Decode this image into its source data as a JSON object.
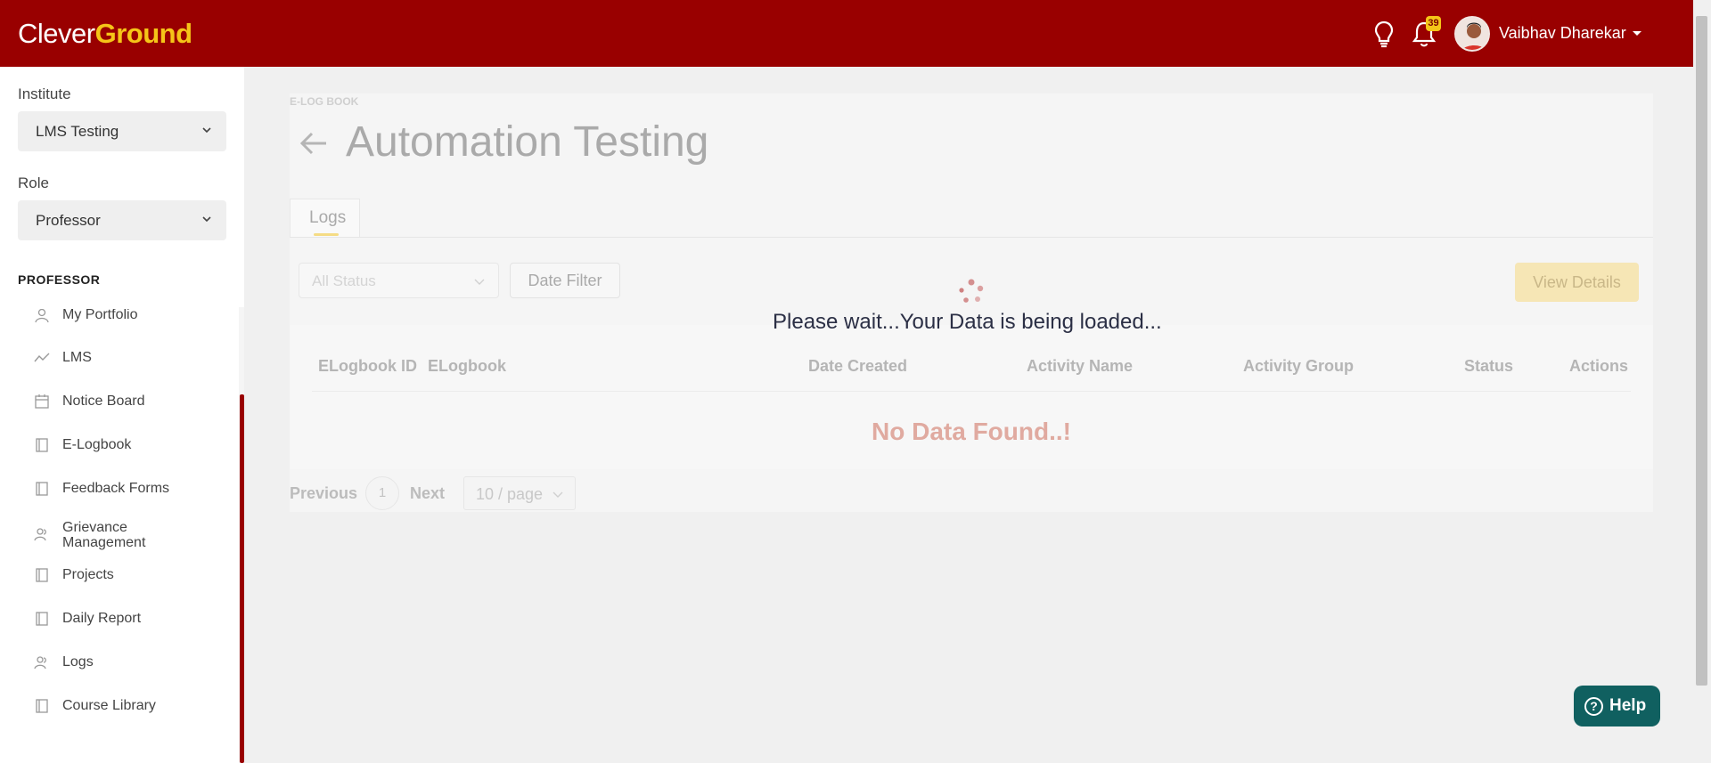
{
  "brand": {
    "logo_part1": "Clever",
    "logo_part2": "Ground",
    "color": "#990000",
    "accent": "#f5c518"
  },
  "header": {
    "notification_count": "39",
    "user_name": "Vaibhav Dharekar",
    "icons": [
      "lightbulb-icon",
      "bell-icon",
      "avatar",
      "caret-down-icon"
    ]
  },
  "sidebar": {
    "institute_label": "Institute",
    "institute_value": "LMS Testing",
    "role_label": "Role",
    "role_value": "Professor",
    "section_title": "PROFESSOR",
    "items": [
      {
        "label": "My Portfolio",
        "icon": "user-icon"
      },
      {
        "label": "LMS",
        "icon": "chart-line-icon"
      },
      {
        "label": "Notice Board",
        "icon": "calendar-icon"
      },
      {
        "label": "E-Logbook",
        "icon": "book-icon"
      },
      {
        "label": "Feedback Forms",
        "icon": "book-icon"
      },
      {
        "label": "Grievance Management",
        "icon": "users-icon"
      },
      {
        "label": "Projects",
        "icon": "book-icon"
      },
      {
        "label": "Daily Report",
        "icon": "book-icon"
      },
      {
        "label": "Logs",
        "icon": "users-icon"
      },
      {
        "label": "Course Library",
        "icon": "book-icon"
      }
    ]
  },
  "main": {
    "breadcrumb": "E-LOG BOOK",
    "title": "Automation Testing",
    "tabs": [
      {
        "label": "Logs"
      }
    ],
    "filters": {
      "status_value": "All Status",
      "date_filter_label": "Date Filter",
      "view_details_label": "View Details"
    },
    "table": {
      "columns": [
        "ELogbook ID",
        "ELogbook",
        "Date Created",
        "Activity Name",
        "Activity Group",
        "Status",
        "Actions"
      ],
      "empty_text": "No Data Found..!"
    },
    "pagination": {
      "prev_label": "Previous",
      "current_page": "1",
      "next_label": "Next",
      "page_size": "10 / page"
    }
  },
  "overlay": {
    "loading_text": "Please wait...Your Data is being loaded..."
  },
  "help": {
    "label": "Help"
  }
}
